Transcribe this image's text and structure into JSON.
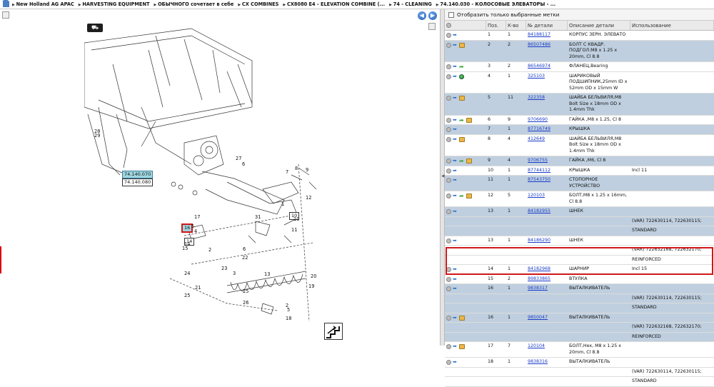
{
  "breadcrumb": [
    "New Holland AG APAC",
    "HARVESTING EQUIPMENT",
    "ОБЫЧНОГО сочетает в себе",
    "CX COMBINES",
    "CX8080 E4 - ELEVATION COMBINE (...",
    "74 - CLEANING",
    "74.140.030 - КОЛОСОВЫЕ ЭЛЕВАТОРЫ - ..."
  ],
  "filter": {
    "label": "Отобразить только выбранные метки"
  },
  "columns": {
    "pos": "Поз.",
    "qty": "К-во",
    "part": "№ детали",
    "desc": "Описание детали",
    "usage": "Использование"
  },
  "callouts": {
    "ref1": "74.140.070",
    "ref2": "74.140.080",
    "sel": "16",
    "c14": "14",
    "c10": "10"
  },
  "diagram_numbers": [
    "28",
    "29",
    "27",
    "6",
    "7",
    "8",
    "9",
    "12",
    "1",
    "31",
    "10",
    "11",
    "17",
    "5",
    "4",
    "15",
    "14",
    "2",
    "6",
    "22",
    "13",
    "23",
    "24",
    "25",
    "21",
    "3",
    "20",
    "19",
    "2",
    "25",
    "26",
    "5",
    "18"
  ],
  "rows": [
    {
      "icons": [
        "info",
        "arrow"
      ],
      "pos": "1",
      "qty": "1",
      "part": "84188117",
      "desc": "КОРПУС ЗЕРН. ЭЛЕВАТО",
      "usage": "",
      "shaded": false
    },
    {
      "icons": [
        "info",
        "arrow",
        "box"
      ],
      "pos": "2",
      "qty": "2",
      "part": "86507486",
      "desc": "БОЛТ С КВАДР. ПОДГОЛ.М8 x 1.25 x 20mm, Cl 8.8",
      "usage": "",
      "shaded": true
    },
    {
      "icons": [
        "info",
        "arrow",
        "green"
      ],
      "pos": "3",
      "qty": "2",
      "part": "86546974",
      "desc": "ФЛАНЕЦ,Bearing",
      "usage": "",
      "shaded": false
    },
    {
      "icons": [
        "info",
        "arrow",
        "globe"
      ],
      "pos": "4",
      "qty": "1",
      "part": "325103",
      "desc": "ШАРИКОВЫЙ ПОДШИПНИК,25mm ID x 52mm OD x 15mm W",
      "usage": "",
      "shaded": false
    },
    {
      "icons": [
        "info",
        "arrow",
        "box"
      ],
      "pos": "5",
      "qty": "11",
      "part": "322358",
      "desc": "ШАЙБА БЕЛЬВИЛЯ,M8 Bolt Size x 18mm OD x 1.4mm Thk",
      "usage": "",
      "shaded": true
    },
    {
      "icons": [
        "info",
        "arrow",
        "green",
        "box"
      ],
      "pos": "6",
      "qty": "9",
      "part": "9706690",
      "desc": "ГАЙКА ,M8 x 1.25, Cl 8",
      "usage": "",
      "shaded": false
    },
    {
      "icons": [
        "info",
        "arrow"
      ],
      "pos": "7",
      "qty": "1",
      "part": "87716749",
      "desc": "КРЫШКА",
      "usage": "",
      "shaded": true
    },
    {
      "icons": [
        "info",
        "arrow",
        "box"
      ],
      "pos": "8",
      "qty": "4",
      "part": "412649",
      "desc": "ШАЙБА БЕЛЬВИЛЯ,M8 Bolt Size x 18mm OD x 1.4mm Thk",
      "usage": "",
      "shaded": false
    },
    {
      "icons": [
        "info",
        "arrow",
        "green",
        "box"
      ],
      "pos": "9",
      "qty": "4",
      "part": "9706755",
      "desc": "ГАЙКА ,M6, Cl 8",
      "usage": "",
      "shaded": true
    },
    {
      "icons": [
        "info",
        "arrow"
      ],
      "pos": "10",
      "qty": "1",
      "part": "87744112",
      "desc": "КРЫШКА",
      "usage": "Incl 11",
      "shaded": false
    },
    {
      "icons": [
        "info",
        "arrow"
      ],
      "pos": "11",
      "qty": "1",
      "part": "87543750",
      "desc": "СТОПОРНОЕ УСТРОЙСТВО",
      "usage": "",
      "shaded": true
    },
    {
      "icons": [
        "info",
        "arrow",
        "green",
        "box"
      ],
      "pos": "12",
      "qty": "5",
      "part": "120103",
      "desc": "БОЛТ,M8 x 1.25 x 16mm, Cl 8.8",
      "usage": "",
      "shaded": false
    },
    {
      "icons": [
        "info",
        "arrow"
      ],
      "pos": "13",
      "qty": "1",
      "part": "84182955",
      "desc": "ШНЕК",
      "usage": "",
      "shaded": true,
      "extra": [
        "(VAR) 722630114, 722630115;",
        "STANDARD"
      ]
    },
    {
      "icons": [
        "info",
        "arrow"
      ],
      "pos": "13",
      "qty": "1",
      "part": "84186290",
      "desc": "ШНЕК",
      "usage": "",
      "shaded": false,
      "extra": [
        "(VAR) 722632168, 722632170;",
        "REINFORCED"
      ]
    },
    {
      "icons": [
        "info",
        "arrow"
      ],
      "pos": "14",
      "qty": "1",
      "part": "84182968",
      "desc": "ШАРНИР",
      "usage": "Incl 15",
      "shaded": false
    },
    {
      "icons": [
        "info",
        "arrow"
      ],
      "pos": "15",
      "qty": "2",
      "part": "89833865",
      "desc": "ВТУЛКА",
      "usage": "",
      "shaded": false
    },
    {
      "icons": [
        "info",
        "arrow"
      ],
      "pos": "16",
      "qty": "1",
      "part": "9838317",
      "desc": "ВЫТАЛКИВАТЕЛЬ",
      "usage": "",
      "shaded": true,
      "selected": true,
      "extra": [
        "(VAR) 722630114, 722630115;",
        "STANDARD"
      ]
    },
    {
      "icons": [
        "info",
        "arrow",
        "box"
      ],
      "pos": "16",
      "qty": "1",
      "part": "9850047",
      "desc": "ВЫТАЛКИВАТЕЛЬ",
      "usage": "",
      "shaded": true,
      "extra": [
        "(VAR) 722632168, 722632170;",
        "REINFORCED"
      ]
    },
    {
      "icons": [
        "info",
        "arrow",
        "box"
      ],
      "pos": "17",
      "qty": "7",
      "part": "120104",
      "desc": "БОЛТ,Hex, M8 x 1.25 x 20mm, Cl 8.8",
      "usage": "",
      "shaded": false
    },
    {
      "icons": [
        "info",
        "arrow"
      ],
      "pos": "18",
      "qty": "1",
      "part": "9838316",
      "desc": "ВЫТАЛКИВАТЕЛЬ",
      "usage": "",
      "shaded": false,
      "extra": [
        "(VAR) 722630114, 722630115;",
        "STANDARD"
      ]
    }
  ]
}
